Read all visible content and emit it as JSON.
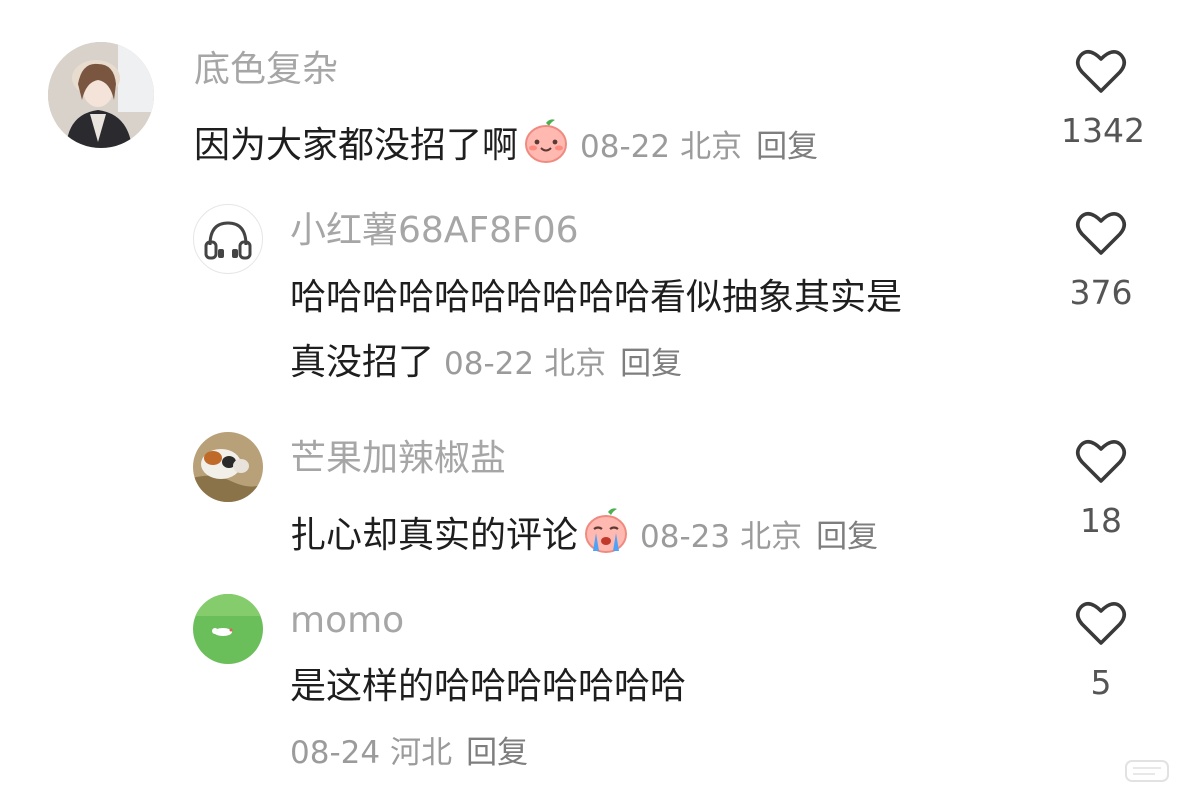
{
  "comments": [
    {
      "user": "底色复杂",
      "text": "因为大家都没招了啊",
      "emoji": "smiling-peach-emoji",
      "date": "08-22",
      "location": "北京",
      "reply_label": "回复",
      "likes": "1342"
    },
    {
      "user": "小红薯68AF8F06",
      "text_line1": "哈哈哈哈哈哈哈哈哈哈看似抽象其实是",
      "text_line2": "真没招了",
      "date": "08-22",
      "location": "北京",
      "reply_label": "回复",
      "likes": "376"
    },
    {
      "user": "芒果加辣椒盐",
      "text": "扎心却真实的评论",
      "emoji": "crying-peach-emoji",
      "date": "08-23",
      "location": "北京",
      "reply_label": "回复",
      "likes": "18"
    },
    {
      "user": "momo",
      "text": "是这样的哈哈哈哈哈哈哈",
      "date": "08-24",
      "location": "河北",
      "reply_label": "回复",
      "likes": "5"
    }
  ],
  "colors": {
    "username": "#a6a6a6",
    "text": "#1e1e1e",
    "meta": "#9b9b9b",
    "heart": "#3a3a3a"
  }
}
